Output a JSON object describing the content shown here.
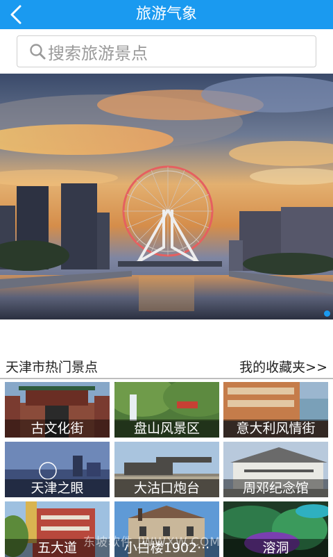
{
  "header": {
    "title": "旅游气象",
    "back_icon": "chevron-left-icon"
  },
  "search": {
    "placeholder": "搜索旅游景点",
    "icon": "search-icon"
  },
  "banner": {
    "description_icon": "banner-photo",
    "pager": {
      "current": 1
    }
  },
  "section": {
    "left_title": "天津市热门景点",
    "right_link": "我的收藏夹>>"
  },
  "attractions": [
    {
      "name": "古文化街"
    },
    {
      "name": "盘山风景区"
    },
    {
      "name": "意大利风情街"
    },
    {
      "name": "天津之眼"
    },
    {
      "name": "大沽口炮台"
    },
    {
      "name": "周邓纪念馆"
    },
    {
      "name": "五大道"
    },
    {
      "name": "小白楼1902···"
    },
    {
      "name": "溶洞"
    }
  ],
  "watermark": "东坡软件 JWWXW.COM",
  "colors": {
    "accent": "#1a9af0"
  }
}
